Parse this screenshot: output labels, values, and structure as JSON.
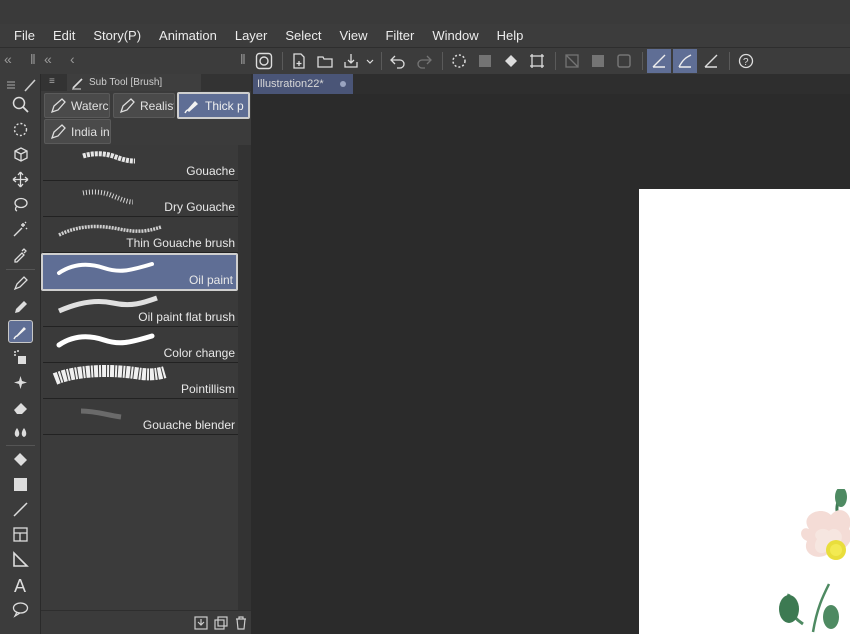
{
  "menu": [
    "File",
    "Edit",
    "Story(P)",
    "Animation",
    "Layer",
    "Select",
    "View",
    "Filter",
    "Window",
    "Help"
  ],
  "subtool_panel": {
    "tab_label": "Sub Tool [Brush]",
    "groups": [
      {
        "label": "Waterco"
      },
      {
        "label": "Realisti"
      },
      {
        "label": "Thick p"
      },
      {
        "label": "India ink"
      }
    ],
    "brushes": [
      {
        "label": "Gouache"
      },
      {
        "label": "Dry Gouache"
      },
      {
        "label": "Thin Gouache brush"
      },
      {
        "label": "Oil paint"
      },
      {
        "label": "Oil paint flat brush"
      },
      {
        "label": "Color change"
      },
      {
        "label": "Pointillism"
      },
      {
        "label": "Gouache blender"
      }
    ],
    "selected_brush": "Oil paint",
    "selected_group": "Thick p"
  },
  "document": {
    "tab_label": "Illustration22*"
  },
  "icons": {
    "tools": [
      "zoom-icon",
      "rotate-icon",
      "3d-object-icon",
      "move-icon",
      "lasso-select-icon",
      "magic-wand-icon",
      "eyedropper-icon",
      "pen-icon",
      "pencil-icon",
      "brush-icon",
      "airbrush-icon",
      "decoration-icon",
      "eraser-icon",
      "blend-icon",
      "fill-icon",
      "gradient-icon",
      "line-icon",
      "frame-icon",
      "ruler-icon",
      "text-icon",
      "balloon-icon"
    ]
  },
  "colors": {
    "accent": "#5f6e95",
    "panel": "#3b3b3b",
    "canvas": "#ffffff"
  }
}
